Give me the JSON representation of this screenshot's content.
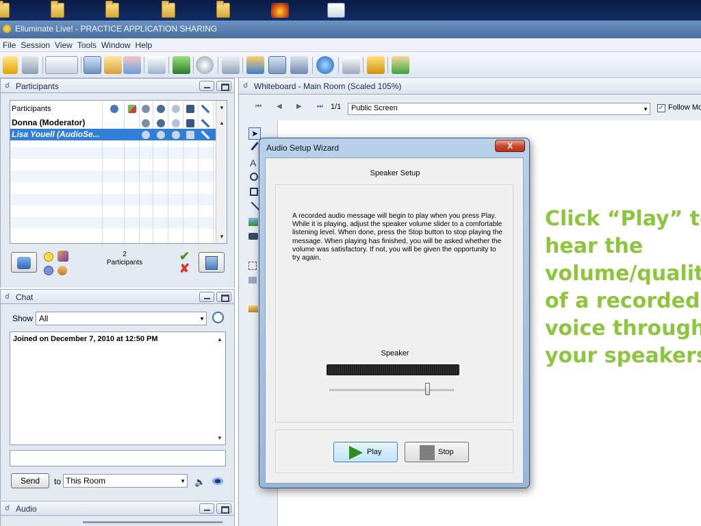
{
  "window": {
    "title": "Elluminate Live! - PRACTICE APPLICATION SHARING"
  },
  "menu": [
    "File",
    "Session",
    "View",
    "Tools",
    "Window",
    "Help"
  ],
  "participants_panel": {
    "title": "Participants",
    "column_header": "Participants",
    "rows": [
      {
        "name": "Donna (Moderator)",
        "selected": false
      },
      {
        "name": "Lisa Youell (AudioSe...",
        "selected": true
      }
    ],
    "count": "2",
    "count_label": "Participants"
  },
  "chat_panel": {
    "title": "Chat",
    "show_label": "Show",
    "show_value": "All",
    "log_line": "Joined on December 7, 2010 at 12:50 PM",
    "send_label": "Send",
    "to_label": "to",
    "to_value": "This Room"
  },
  "audio_panel": {
    "title": "Audio"
  },
  "whiteboard": {
    "title": "Whiteboard - Main Room (Scaled 105%)",
    "page": "1/1",
    "screen": "Public Screen",
    "follow_label": "Follow Mo"
  },
  "dialog": {
    "title": "Audio Setup Wizard",
    "close": "X",
    "section": "Speaker Setup",
    "message": "A recorded audio message will begin to play when you press Play.  While it is playing, adjust the speaker volume slider to a comfortable listening level.  When done, press the Stop button to stop playing the message. When playing has finished, you will be asked whether the volume was satisfactory.  If not, you will be given the opportunity to try again.",
    "speaker_label": "Speaker",
    "speaker_volume": 0.8,
    "play_label": "Play",
    "stop_label": "Stop"
  },
  "annotation": "Click “Play” to\nhear the\nvolume/quality\nof a recorded\nvoice through\nyour speakers",
  "colors": {
    "annotation": "#8dc53d",
    "selected_row": "#2f7fd8",
    "close_button": "#c6452a"
  }
}
